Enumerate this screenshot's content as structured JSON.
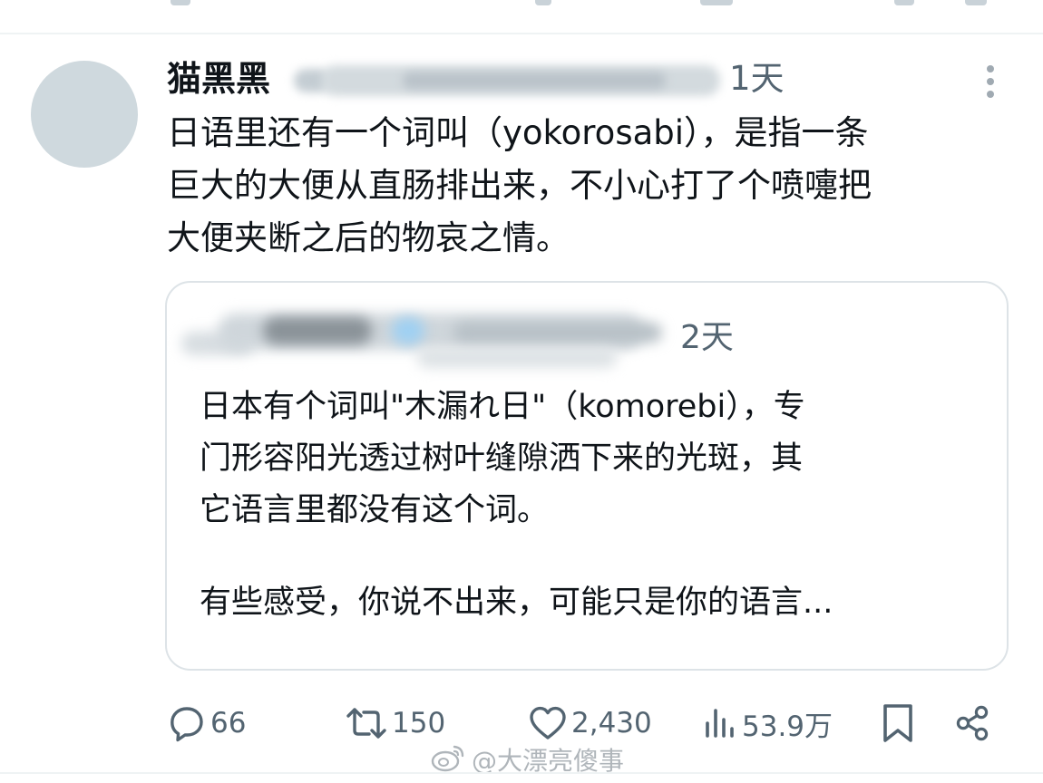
{
  "tweet": {
    "author": {
      "display_name": "猫黑黑"
    },
    "timestamp": "1天",
    "text_lines": [
      "日语里还有一个词叫（yokorosabi），是指一条",
      "巨大的大便从直肠排出来，不小心打了个喷嚏把",
      "大便夹断之后的物哀之情。"
    ],
    "quoted_tweet": {
      "timestamp": "2天",
      "text_lines": [
        "日本有个词叫\"木漏れ日\"（komorebi），专",
        "门形容阳光透过树叶缝隙洒下来的光斑，其",
        "它语言里都没有这个词。"
      ],
      "text_lines_2": [
        "有些感受，你说不出来，可能只是你的语言..."
      ]
    },
    "actions": {
      "replies": "66",
      "reposts": "150",
      "likes": "2,430",
      "views": "53.9万"
    }
  },
  "icons": {
    "more": "more-vertical-icon",
    "reply": "reply-icon",
    "repost": "repost-icon",
    "like": "heart-icon",
    "views": "views-chart-icon",
    "bookmark": "bookmark-icon",
    "share": "share-icon",
    "watermark_logo": "weibo-logo-icon"
  },
  "watermark": {
    "text": "@大漂亮傻事"
  },
  "colors": {
    "text_primary": "#0f1419",
    "text_secondary": "#536471",
    "avatar_placeholder": "#cfd9de",
    "border": "#dde3e7",
    "divider": "#eff3f4"
  }
}
